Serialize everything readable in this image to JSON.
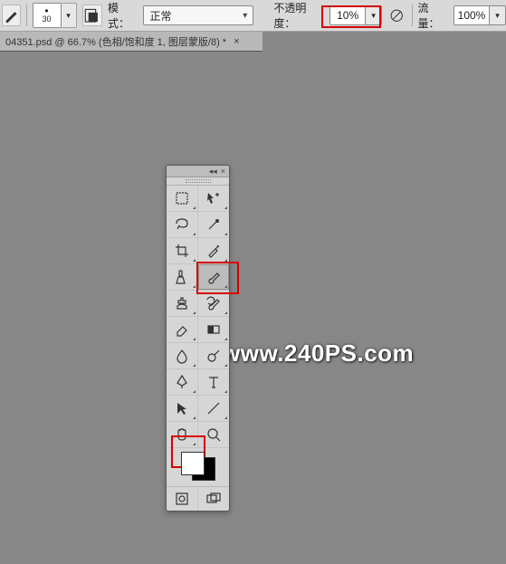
{
  "options_bar": {
    "brush_size": "30",
    "mode_label": "模式：",
    "mode_value": "正常",
    "opacity_label": "不透明度：",
    "opacity_value": "10%",
    "flow_label": "流量：",
    "flow_value": "100%"
  },
  "document_tab": {
    "title": "04351.psd @ 66.7% (色相/饱和度 1, 图层蒙版/8) *"
  },
  "watermark": "www.240PS.com",
  "tools_panel": {
    "foreground_color": "#ffffff",
    "background_color": "#000000",
    "tools": [
      [
        "rectangular-marquee-tool",
        "move-tool"
      ],
      [
        "lasso-tool",
        "magic-wand-tool"
      ],
      [
        "crop-tool",
        "eyedropper-tool"
      ],
      [
        "spot-healing-brush-tool",
        "brush-tool"
      ],
      [
        "clone-stamp-tool",
        "history-brush-tool"
      ],
      [
        "eraser-tool",
        "gradient-tool"
      ],
      [
        "blur-tool",
        "dodge-tool"
      ],
      [
        "pen-tool",
        "horizontal-type-tool"
      ],
      [
        "path-selection-tool",
        "line-tool"
      ],
      [
        "hand-tool",
        "zoom-tool"
      ]
    ],
    "footer_tools": [
      "quick-mask-toggle",
      "screen-mode-toggle"
    ]
  },
  "highlights": {
    "opacity_field": true,
    "brush_tool": true,
    "foreground_swatch": true
  }
}
